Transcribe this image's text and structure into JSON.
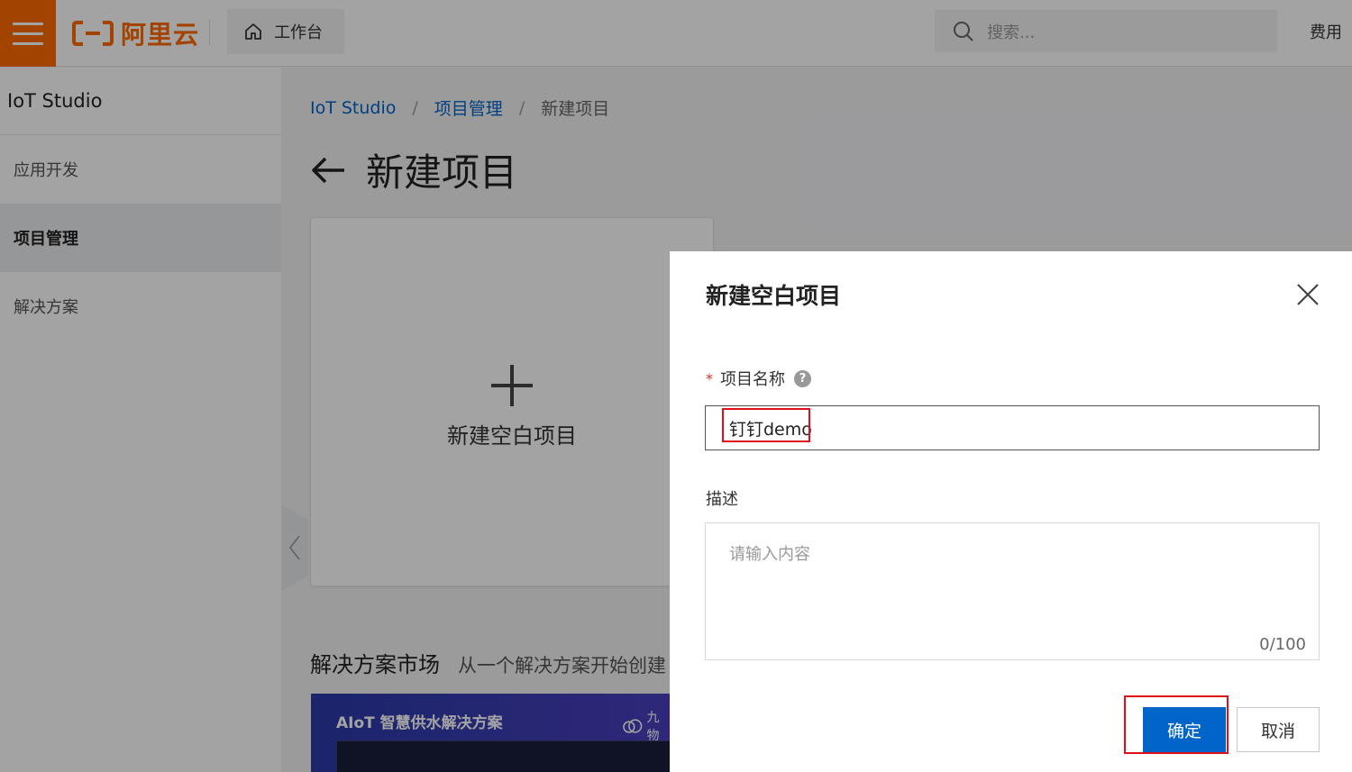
{
  "topbar": {
    "logo_text": "阿里云",
    "workbench_label": "工作台",
    "search_placeholder": "搜索...",
    "fee_label": "费用"
  },
  "sidebar": {
    "title": "IoT Studio",
    "items": [
      {
        "label": "应用开发",
        "active": false
      },
      {
        "label": "项目管理",
        "active": true
      },
      {
        "label": "解决方案",
        "active": false
      }
    ]
  },
  "breadcrumb": {
    "items": [
      "IoT Studio",
      "项目管理",
      "新建项目"
    ],
    "separator": "/"
  },
  "page": {
    "title": "新建项目",
    "new_card_label": "新建空白项目",
    "market_title": "解决方案市场",
    "market_subtitle": "从一个解决方案开始创建",
    "solution_title": "AIoT 智慧供水解决方案",
    "solution_brand": "九物"
  },
  "dialog": {
    "title": "新建空白项目",
    "name_label": "项目名称",
    "name_required_mark": "*",
    "name_value": "钉钉demo",
    "desc_label": "描述",
    "desc_placeholder": "请输入内容",
    "desc_counter": "0/100",
    "ok_label": "确定",
    "cancel_label": "取消"
  },
  "colors": {
    "brand_orange": "#ff6a00",
    "primary_blue": "#0064c8",
    "highlight_red": "#e0101b"
  }
}
